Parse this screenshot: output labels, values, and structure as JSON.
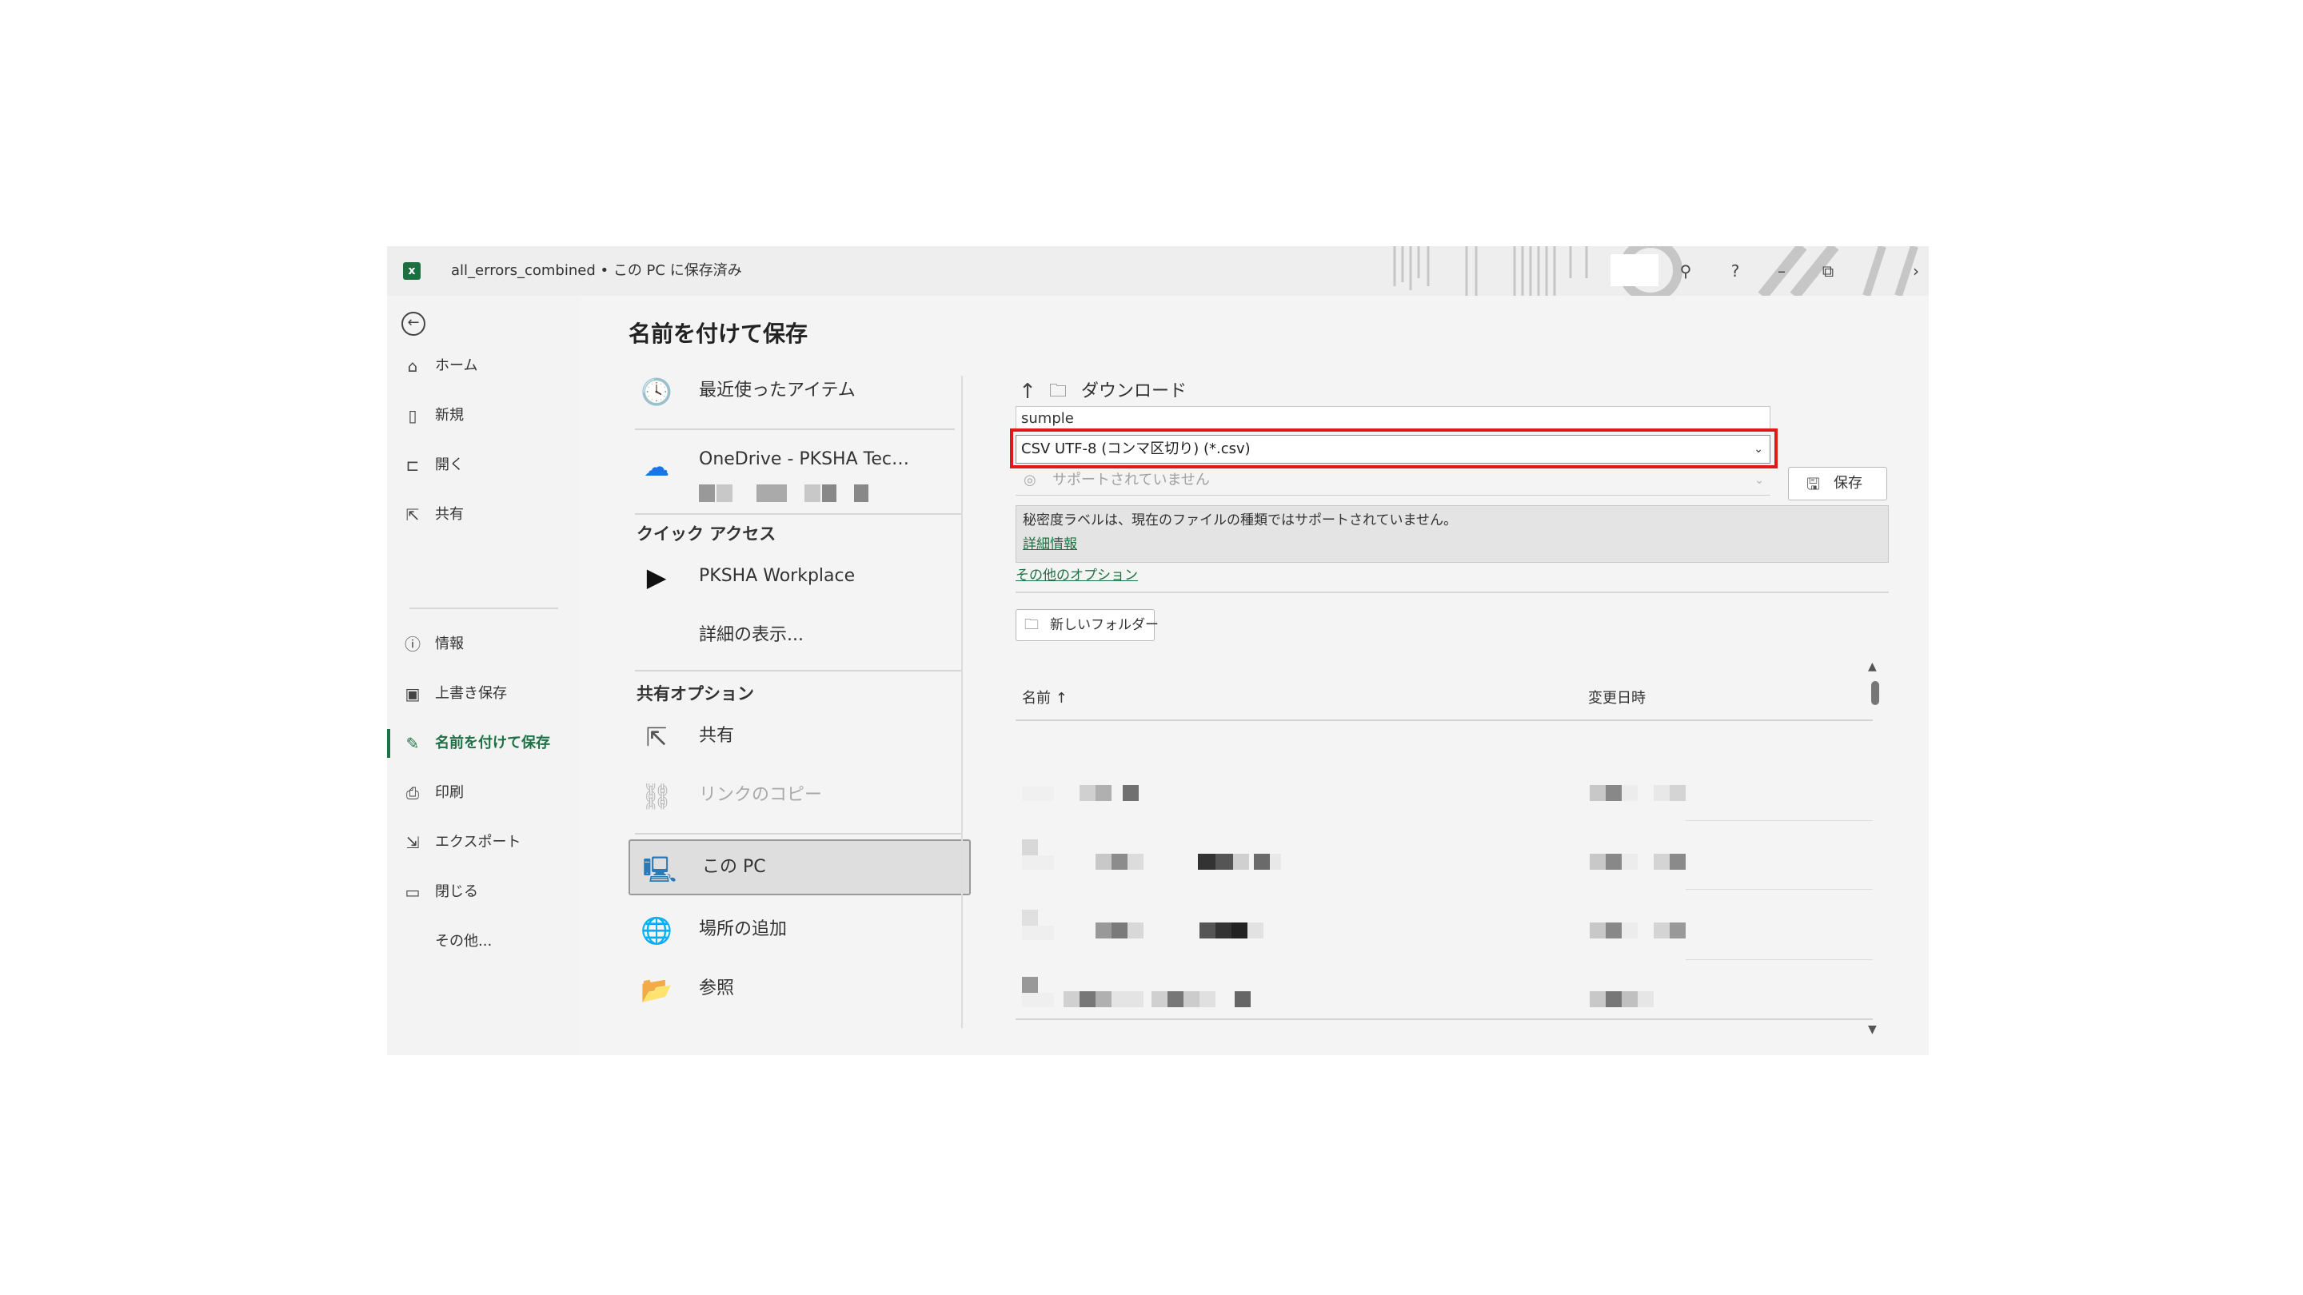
{
  "window": {
    "title": "all_errors_combined • この PC に保存済み",
    "app_icon": "excel-icon",
    "controls": {
      "minimize": "–",
      "restore": "⧉",
      "help": "?",
      "close": "›"
    }
  },
  "nav": {
    "back_icon": "back-arrow-icon",
    "items": [
      {
        "label": "ホーム",
        "icon": "home-icon"
      },
      {
        "label": "新規",
        "icon": "new-document-icon"
      },
      {
        "label": "開く",
        "icon": "open-folder-icon"
      },
      {
        "label": "共有",
        "icon": "share-icon"
      },
      {
        "label": "情報",
        "icon": "info-icon"
      },
      {
        "label": "上書き保存",
        "icon": "save-icon"
      },
      {
        "label": "名前を付けて保存",
        "icon": "save-as-icon",
        "active": true
      },
      {
        "label": "印刷",
        "icon": "print-icon"
      },
      {
        "label": "エクスポート",
        "icon": "export-icon"
      },
      {
        "label": "閉じる",
        "icon": "close-folder-icon"
      },
      {
        "label": "その他...",
        "icon": ""
      }
    ]
  },
  "main": {
    "title": "名前を付けて保存",
    "locations": {
      "recent": "最近使ったアイテム",
      "onedrive": "OneDrive - PKSHA Tec…",
      "quick_access_header": "クイック アクセス",
      "pksha_workplace": "PKSHA Workplace",
      "show_more": "詳細の表示...",
      "share_options_header": "共有オプション",
      "share": "共有",
      "copy_link": "リンクのコピー",
      "this_pc": "この PC",
      "add_place": "場所の追加",
      "browse": "参照"
    },
    "right": {
      "breadcrumb": "ダウンロード",
      "filename_value": "sumple",
      "filetype_value": "CSV UTF-8 (コンマ区切り) (*.csv)",
      "sensitivity_value": "サポートされていません",
      "save_button": "保存",
      "info_message": "秘密度ラベルは、現在のファイルの種類ではサポートされていません。",
      "info_link": "詳細情報",
      "more_options": "その他のオプション",
      "new_folder": "新しいフォルダー",
      "col_name": "名前 ↑",
      "col_modified": "変更日時"
    }
  },
  "colors": {
    "accent": "#1e7145",
    "highlight_border": "#e01818"
  }
}
